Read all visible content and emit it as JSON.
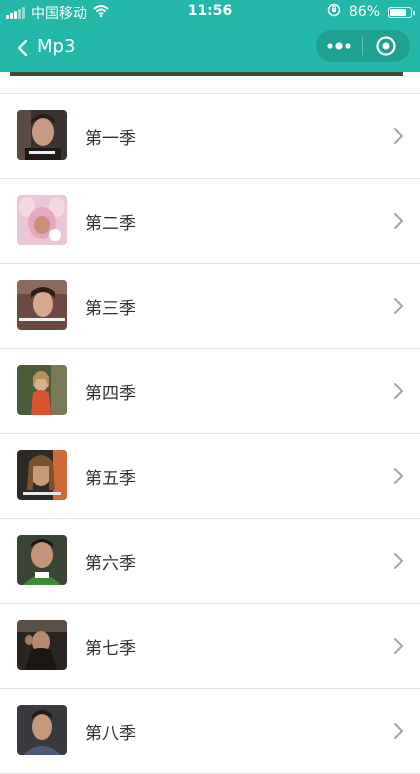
{
  "status_bar": {
    "carrier": "中国移动",
    "time": "11:56",
    "battery": "86%",
    "battery_level": 0.86
  },
  "nav": {
    "title": "Mp3"
  },
  "accent": "#23b8a7",
  "seasons": [
    {
      "label": "第一季"
    },
    {
      "label": "第二季"
    },
    {
      "label": "第三季"
    },
    {
      "label": "第四季"
    },
    {
      "label": "第五季"
    },
    {
      "label": "第六季"
    },
    {
      "label": "第七季"
    },
    {
      "label": "第八季"
    }
  ]
}
